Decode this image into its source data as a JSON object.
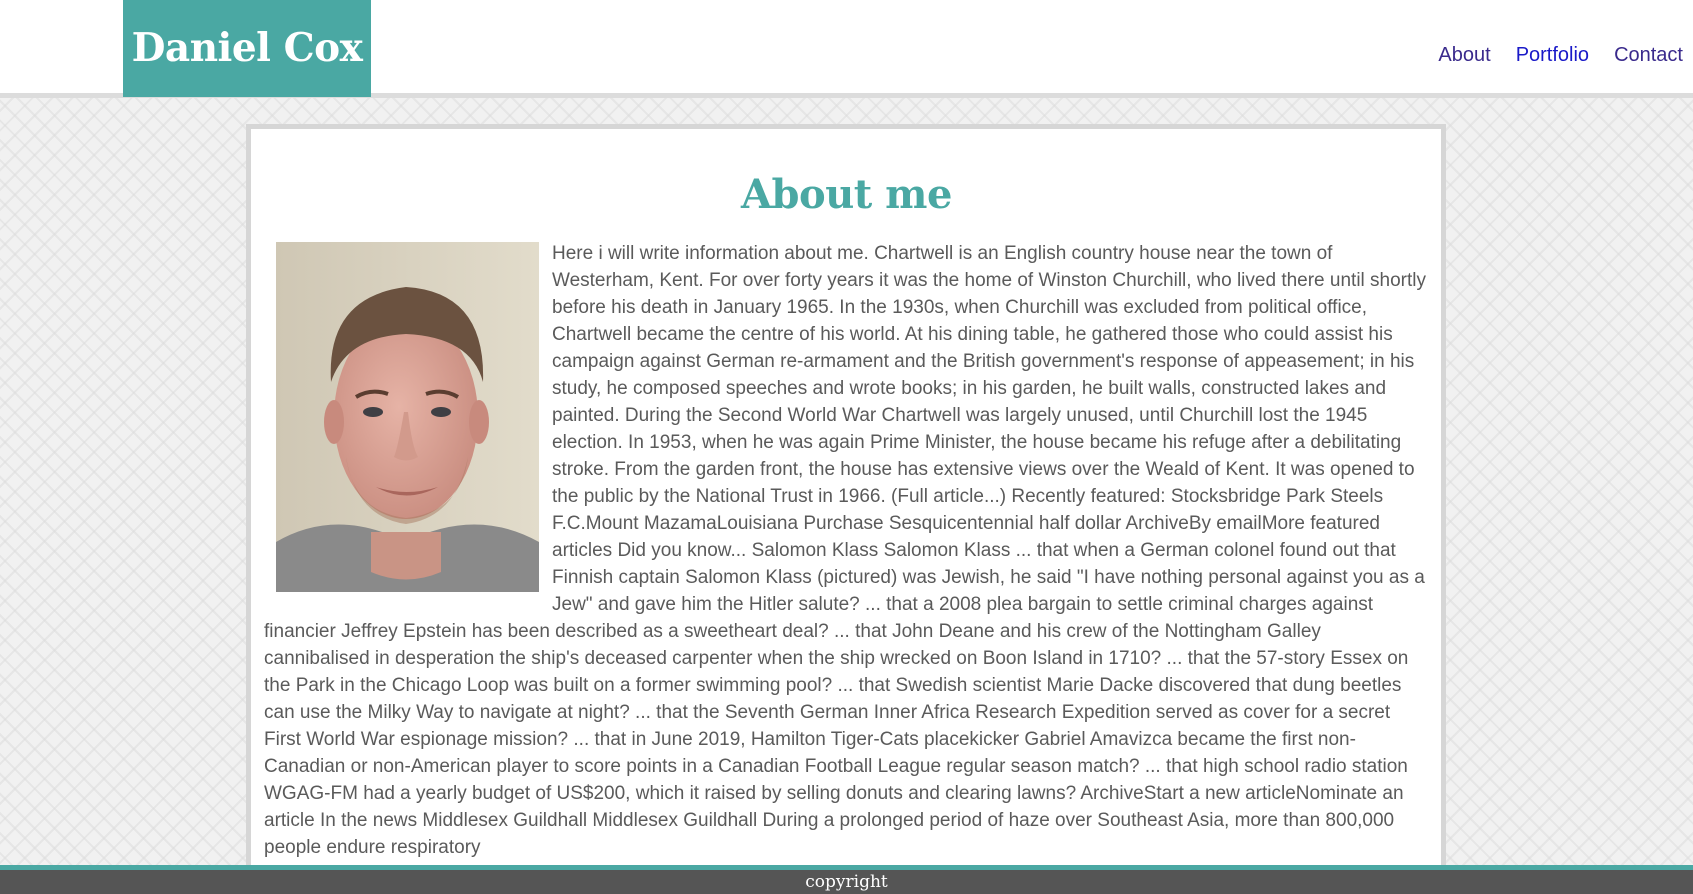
{
  "header": {
    "logo_text": "Daniel Cox",
    "nav": [
      {
        "label": "About"
      },
      {
        "label": "Portfolio"
      },
      {
        "label": "Contact"
      }
    ]
  },
  "main": {
    "heading": "About me",
    "bio": "Here i will write information about me. Chartwell is an English country house near the town of Westerham, Kent. For over forty years it was the home of Winston Churchill, who lived there until shortly before his death in January 1965. In the 1930s, when Churchill was excluded from political office, Chartwell became the centre of his world. At his dining table, he gathered those who could assist his campaign against German re-armament and the British government's response of appeasement; in his study, he composed speeches and wrote books; in his garden, he built walls, constructed lakes and painted. During the Second World War Chartwell was largely unused, until Churchill lost the 1945 election. In 1953, when he was again Prime Minister, the house became his refuge after a debilitating stroke. From the garden front, the house has extensive views over the Weald of Kent. It was opened to the public by the National Trust in 1966. (Full article...) Recently featured: Stocksbridge Park Steels F.C.Mount MazamaLouisiana Purchase Sesquicentennial half dollar ArchiveBy emailMore featured articles Did you know... Salomon Klass Salomon Klass ... that when a German colonel found out that Finnish captain Salomon Klass (pictured) was Jewish, he said \"I have nothing personal against you as a Jew\" and gave him the Hitler salute? ... that a 2008 plea bargain to settle criminal charges against financier Jeffrey Epstein has been described as a sweetheart deal? ... that John Deane and his crew of the Nottingham Galley cannibalised in desperation the ship's deceased carpenter when the ship wrecked on Boon Island in 1710? ... that the 57-story Essex on the Park in the Chicago Loop was built on a former swimming pool? ... that Swedish scientist Marie Dacke discovered that dung beetles can use the Milky Way to navigate at night? ... that the Seventh German Inner Africa Research Expedition served as cover for a secret First World War espionage mission? ... that in June 2019, Hamilton Tiger-Cats placekicker Gabriel Amavizca became the first non-Canadian or non-American player to score points in a Canadian Football League regular season match? ... that high school radio station WGAG-FM had a yearly budget of US$200, which it raised by selling donuts and clearing lawns? ArchiveStart a new articleNominate an article In the news Middlesex Guildhall Middlesex Guildhall During a prolonged period of haze over Southeast Asia, more than 800,000 people endure respiratory"
  },
  "footer": {
    "text": "copyright"
  },
  "colors": {
    "accent": "#4aa8a3",
    "nav_link": "#3a2a8c",
    "nav_link_active": "#1a1ac8",
    "footer_bg": "#555555",
    "body_text": "#5a5a5a"
  }
}
